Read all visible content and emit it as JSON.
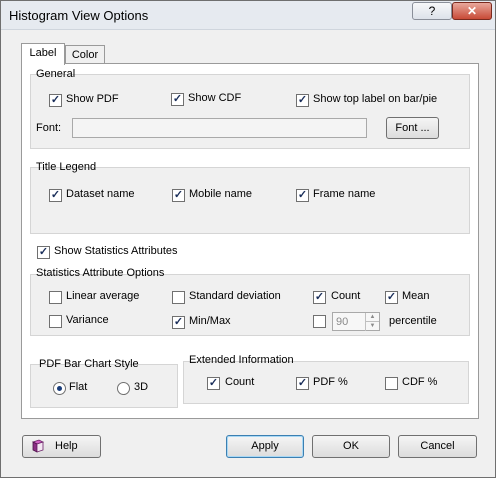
{
  "window": {
    "title": "Histogram View Options",
    "help_glyph": "?",
    "close_glyph": "✕"
  },
  "tabs": [
    {
      "label": "Label",
      "active": true
    },
    {
      "label": "Color",
      "active": false
    }
  ],
  "general": {
    "title": "General",
    "show_pdf": {
      "label": "Show PDF",
      "checked": true
    },
    "show_cdf": {
      "label": "Show CDF",
      "checked": true
    },
    "show_top_label": {
      "label": "Show top label on bar/pie",
      "checked": true
    },
    "font_label": "Font:",
    "font_value": "",
    "font_button": "Font ..."
  },
  "title_legend": {
    "title": "Title  Legend",
    "dataset_name": {
      "label": "Dataset name",
      "checked": true
    },
    "mobile_name": {
      "label": "Mobile name",
      "checked": true
    },
    "frame_name": {
      "label": "Frame name",
      "checked": true
    }
  },
  "show_stats": {
    "label": "Show Statistics Attributes",
    "checked": true
  },
  "stats_options": {
    "title": "Statistics Attribute Options",
    "linear_average": {
      "label": "Linear average",
      "checked": false
    },
    "standard_deviation": {
      "label": "Standard deviation",
      "checked": false
    },
    "count": {
      "label": "Count",
      "checked": true
    },
    "mean": {
      "label": "Mean",
      "checked": true
    },
    "variance": {
      "label": "Variance",
      "checked": false
    },
    "min_max": {
      "label": "Min/Max",
      "checked": true
    },
    "percentile": {
      "checked": false,
      "value": "90",
      "label": "percentile",
      "up_glyph": "▲",
      "down_glyph": "▼"
    }
  },
  "pdf_bar_style": {
    "title": "PDF Bar Chart Style",
    "flat": {
      "label": "Flat",
      "selected": true
    },
    "three_d": {
      "label": "3D",
      "selected": false
    }
  },
  "extended_info": {
    "title": "Extended Information",
    "count": {
      "label": "Count",
      "checked": true
    },
    "pdf_pct": {
      "label": "PDF %",
      "checked": true
    },
    "cdf_pct": {
      "label": "CDF %",
      "checked": false
    }
  },
  "footer": {
    "help_label": "Help",
    "help_icon": "book-icon",
    "apply_label": "Apply",
    "ok_label": "OK",
    "cancel_label": "Cancel"
  },
  "check_glyph": "✓",
  "colors": {
    "accent": "#3c7fb1",
    "close": "#c84a36"
  }
}
